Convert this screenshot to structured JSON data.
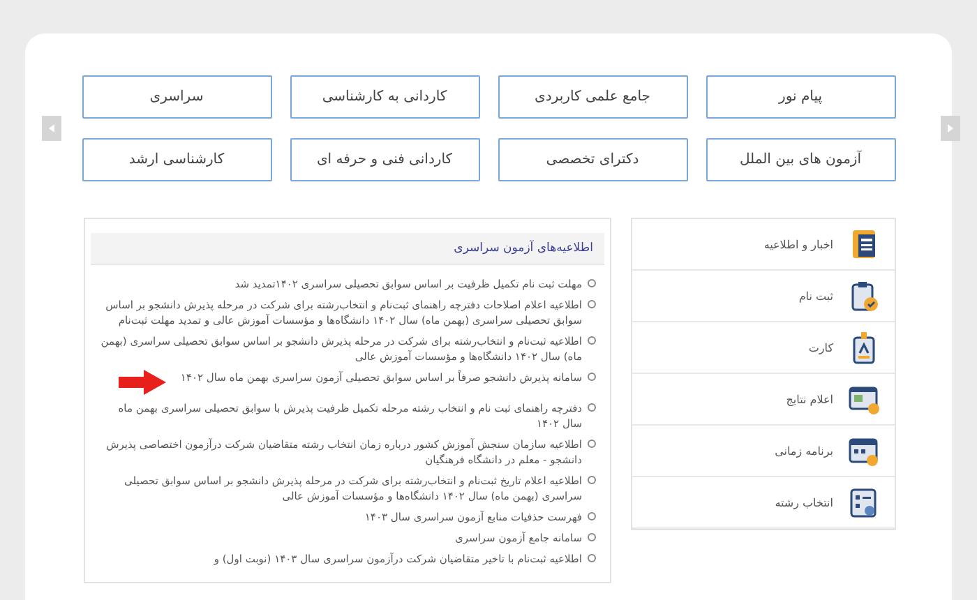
{
  "categories": [
    {
      "label": "پیام نور"
    },
    {
      "label": "جامع علمی کاربردی"
    },
    {
      "label": "کاردانی به کارشناسی"
    },
    {
      "label": "سراسری"
    },
    {
      "label": "آزمون های بین الملل"
    },
    {
      "label": "دکترای تخصصی"
    },
    {
      "label": "کاردانی فنی و حرفه ای"
    },
    {
      "label": "کارشناسی ارشد"
    }
  ],
  "sidebar": {
    "items": [
      {
        "label": "اخبار و اطلاعیه",
        "kind": "news"
      },
      {
        "label": "ثبت نام",
        "kind": "register"
      },
      {
        "label": "کارت",
        "kind": "card"
      },
      {
        "label": "اعلام نتایج",
        "kind": "results"
      },
      {
        "label": "برنامه زمانی",
        "kind": "calendar"
      },
      {
        "label": "انتخاب رشته",
        "kind": "choice"
      }
    ]
  },
  "announcements": {
    "title": "اطلاعیه‌های آزمون سراسری",
    "items": [
      {
        "text": "مهلت ثبت نام تکمیل ظرفیت بر اساس سوابق تحصیلی سراسری ۱۴۰۲تمدید شد",
        "highlighted": false
      },
      {
        "text": "اطلاعیه اعلام اصلاحات دفترچه راهنمای ثبت‌نام و انتخاب‌رشته برای شرکت در مرحله پذیرش دانشجو بر اساس سوابق تحصیلی سراسری (بهمن ماه) سال ۱۴۰۲ دانشگاه‌ها و مؤسسات آموزش عالی و تمدید مهلت ثبت‌نام",
        "highlighted": false
      },
      {
        "text": "اطلاعیه ثبت‌نام و انتخاب‌رشته برای شرکت در مرحله پذیرش دانشجو بر اساس سوابق تحصیلی سراسری (بهمن ماه) سال ۱۴۰۲ دانشگاه‌ها و مؤسسات آموزش عالی",
        "highlighted": false
      },
      {
        "text": "سامانه پذیرش دانشجو صرفاً بر اساس سوابق تحصیلی آزمون سراسری بهمن ماه سال ۱۴۰۲",
        "highlighted": true
      },
      {
        "text": "دفترچه راهنمای ثبت نام و انتخاب رشته مرحله تکمیل ظرفیت پذیرش با سوابق تحصیلی سراسری بهمن ماه سال ۱۴۰۲",
        "highlighted": false
      },
      {
        "text": "اطلاعیه سازمان سنجش آموزش کشور درباره زمان انتخاب رشته متقاضیان شرکت درآزمون اختصاصی پذیرش دانشجو - معلم در دانشگاه فرهنگیان",
        "highlighted": false
      },
      {
        "text": "اطلاعیه اعلام تاریخ ثبت‌نام و انتخاب‌رشته برای شرکت در مرحله پذیرش دانشجو بر اساس سوابق تحصیلی سراسری (بهمن ماه) سال ۱۴۰۲ دانشگاه‌ها و مؤسسات آموزش عالی",
        "highlighted": false
      },
      {
        "text": "فهرست حذفیات منابع آزمون سراسری سال ۱۴۰۳",
        "highlighted": false
      },
      {
        "text": "سامانه جامع آزمون سراسری",
        "highlighted": false
      },
      {
        "text": "اطلاعیه ثبت‌نام با تاخیر متقاضیان شرکت درآزمون سراسری سال ۱۴۰۳ (نوبت اول) و",
        "highlighted": false
      }
    ]
  }
}
